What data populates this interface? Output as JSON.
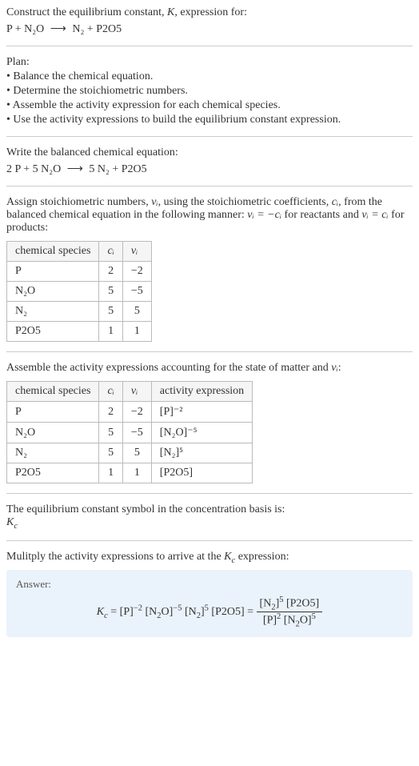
{
  "header": {
    "construct": "Construct the equilibrium constant, ",
    "k": "K",
    "expression_for": ", expression for:",
    "equation_lhs": "P + N₂O",
    "equation_rhs": "N₂ + P2O5"
  },
  "plan": {
    "title": "Plan:",
    "items": [
      "• Balance the chemical equation.",
      "• Determine the stoichiometric numbers.",
      "• Assemble the activity expression for each chemical species.",
      "• Use the activity expressions to build the equilibrium constant expression."
    ]
  },
  "balanced": {
    "title": "Write the balanced chemical equation:",
    "lhs": "2 P + 5 N₂O",
    "rhs": "5 N₂ + P2O5"
  },
  "assign": {
    "title_a": "Assign stoichiometric numbers, ",
    "nu_i": "νᵢ",
    "title_b": ", using the stoichiometric coefficients, ",
    "c_i": "cᵢ",
    "title_c": ", from the balanced chemical equation in the following manner: ",
    "rel1": "νᵢ = −cᵢ",
    "title_d": " for reactants and ",
    "rel2": "νᵢ = cᵢ",
    "title_e": " for products:"
  },
  "table1": {
    "headers": [
      "chemical species",
      "cᵢ",
      "νᵢ"
    ],
    "rows": [
      [
        "P",
        "2",
        "−2"
      ],
      [
        "N₂O",
        "5",
        "−5"
      ],
      [
        "N₂",
        "5",
        "5"
      ],
      [
        "P2O5",
        "1",
        "1"
      ]
    ]
  },
  "assemble": {
    "title_a": "Assemble the activity expressions accounting for the state of matter and ",
    "nu_i": "νᵢ",
    "title_b": ":"
  },
  "table2": {
    "headers": [
      "chemical species",
      "cᵢ",
      "νᵢ",
      "activity expression"
    ],
    "rows": [
      {
        "sp": "P",
        "c": "2",
        "v": "−2",
        "act": "[P]⁻²"
      },
      {
        "sp": "N₂O",
        "c": "5",
        "v": "−5",
        "act": "[N₂O]⁻⁵"
      },
      {
        "sp": "N₂",
        "c": "5",
        "v": "5",
        "act": "[N₂]⁵"
      },
      {
        "sp": "P2O5",
        "c": "1",
        "v": "1",
        "act": "[P2O5]"
      }
    ]
  },
  "symbol": {
    "title": "The equilibrium constant symbol in the concentration basis is:",
    "kc": "K_c"
  },
  "multiply": {
    "title_a": "Mulitply the activity expressions to arrive at the ",
    "kc": "K_c",
    "title_b": " expression:"
  },
  "answer": {
    "label": "Answer:",
    "prefix": "K_c = [P]⁻² [N₂O]⁻⁵ [N₂]⁵ [P2O5] = ",
    "frac_num": "[N₂]⁵ [P2O5]",
    "frac_den": "[P]² [N₂O]⁵"
  }
}
